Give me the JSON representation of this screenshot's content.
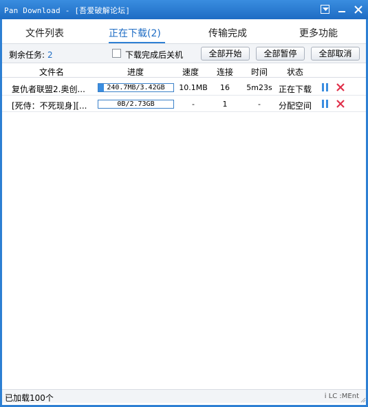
{
  "window": {
    "title": "Pan Download - [吾爱破解论坛]",
    "accent_color": "#2d7fd3"
  },
  "tabs": [
    {
      "label": "文件列表",
      "active": false
    },
    {
      "label": "正在下载(2)",
      "active": true
    },
    {
      "label": "传输完成",
      "active": false
    },
    {
      "label": "更多功能",
      "active": false
    }
  ],
  "toolbar": {
    "remaining_label": "剩余任务:",
    "remaining_count": "2",
    "shutdown_checkbox_label": "下载完成后关机",
    "shutdown_checked": false,
    "start_all_label": "全部开始",
    "pause_all_label": "全部暂停",
    "cancel_all_label": "全部取消"
  },
  "table": {
    "columns": [
      "文件名",
      "进度",
      "速度",
      "连接",
      "时间",
      "状态"
    ],
    "rows": [
      {
        "name": "复仇者联盟2.奥创...",
        "progress_text": "240.7MB/3.42GB",
        "progress_fraction": 0.07,
        "speed": "10.1MB",
        "connections": "16",
        "time": "5m23s",
        "status": "正在下载"
      },
      {
        "name": "[死侍：不死现身][...",
        "progress_text": "0B/2.73GB",
        "progress_fraction": 0.0,
        "speed": "-",
        "connections": "1",
        "time": "-",
        "status": "分配空间"
      }
    ]
  },
  "statusbar": {
    "loaded_text": "已加载100个",
    "right_text": "i LC :MEnt"
  },
  "icons": {
    "menu": "dropdown-menu-icon",
    "minimize": "minimize-icon",
    "close": "close-icon",
    "pause": "pause-icon",
    "delete": "delete-x-icon"
  }
}
